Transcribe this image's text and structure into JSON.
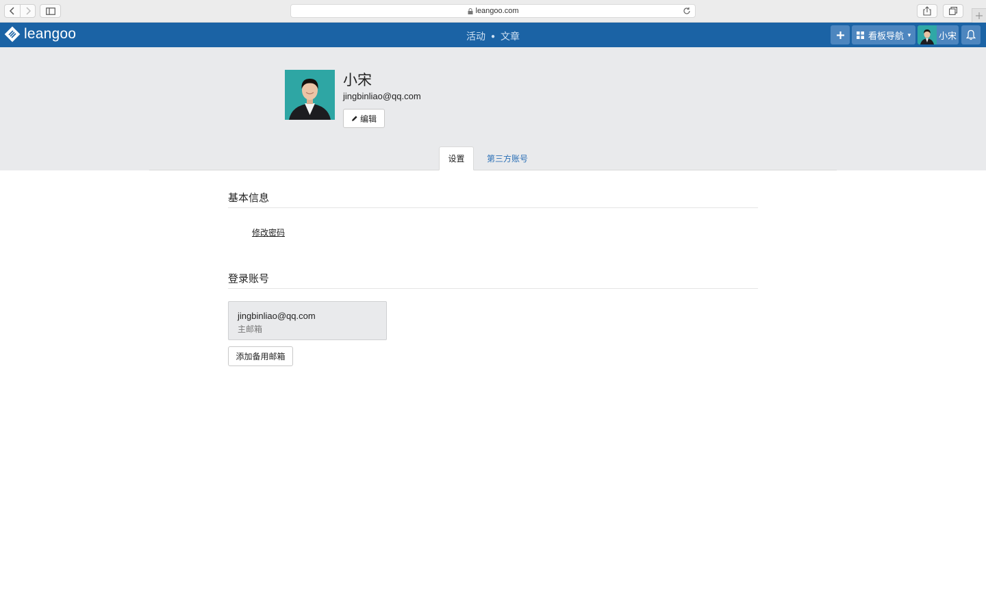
{
  "browser": {
    "url": "leangoo.com"
  },
  "header": {
    "brand": "leangoo",
    "links": [
      "活动",
      "文章"
    ],
    "board_nav_label": "看板导航",
    "user_name": "小宋"
  },
  "profile": {
    "name": "小宋",
    "email": "jingbinliao@qq.com",
    "edit_label": "编辑"
  },
  "tabs": [
    {
      "label": "设置",
      "active": true
    },
    {
      "label": "第三方账号",
      "active": false
    }
  ],
  "basic_info": {
    "title": "基本信息",
    "change_password_label": "修改密码"
  },
  "login_accounts": {
    "title": "登录账号",
    "accounts": [
      {
        "email": "jingbinliao@qq.com",
        "type": "主邮箱"
      }
    ],
    "add_backup_label": "添加备用邮箱"
  },
  "colors": {
    "header_blue": "#1b63a5",
    "link_blue": "#2a6fb6",
    "profile_bg": "#e9eaec"
  }
}
